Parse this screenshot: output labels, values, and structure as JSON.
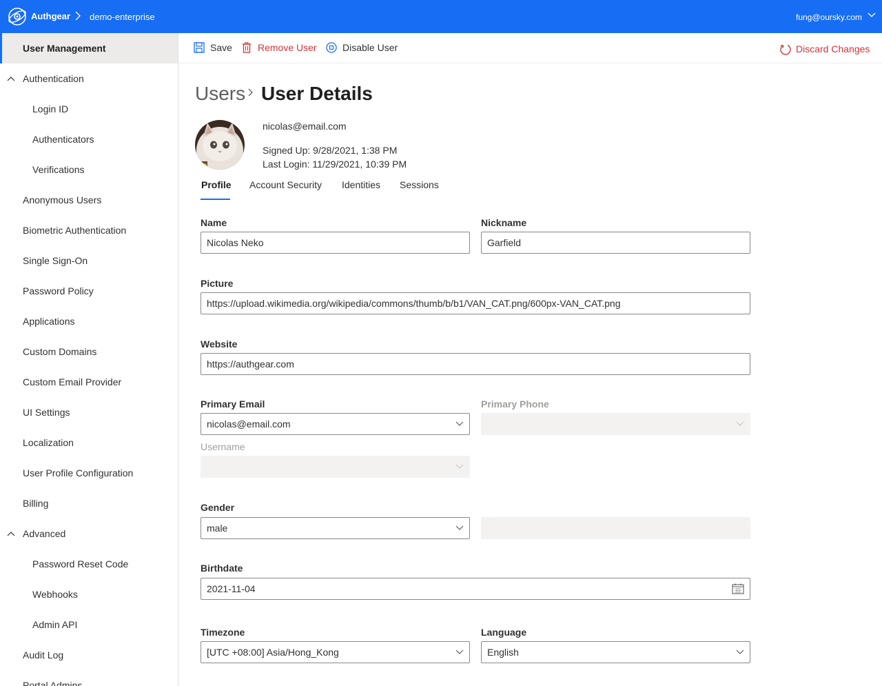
{
  "topbar": {
    "brand": "Authgear",
    "project": "demo-enterprise",
    "user_email": "fung@oursky.com",
    "color": "#176df3"
  },
  "sidebar": {
    "items": [
      {
        "label": "User Management",
        "active": true
      },
      {
        "label": "Authentication",
        "expanded": true
      },
      {
        "label": "Login ID"
      },
      {
        "label": "Authenticators"
      },
      {
        "label": "Verifications"
      },
      {
        "label": "Anonymous Users"
      },
      {
        "label": "Biometric Authentication"
      },
      {
        "label": "Single Sign-On"
      },
      {
        "label": "Password Policy"
      },
      {
        "label": "Applications"
      },
      {
        "label": "Custom Domains"
      },
      {
        "label": "Custom Email Provider"
      },
      {
        "label": "UI Settings"
      },
      {
        "label": "Localization"
      },
      {
        "label": "User Profile Configuration"
      },
      {
        "label": "Billing"
      },
      {
        "label": "Advanced",
        "expanded": true
      },
      {
        "label": "Password Reset Code"
      },
      {
        "label": "Webhooks"
      },
      {
        "label": "Admin API"
      },
      {
        "label": "Audit Log"
      },
      {
        "label": "Portal Admins"
      }
    ]
  },
  "commandbar": {
    "save": "Save",
    "remove_user": "Remove User",
    "disable_user": "Disable User",
    "discard_changes": "Discard Changes",
    "danger_color": "#d13438"
  },
  "header": {
    "breadcrumb_parent": "Users",
    "title": "User Details"
  },
  "user": {
    "email": "nicolas@email.com",
    "signed_up": "Signed Up: 9/28/2021, 1:38 PM",
    "last_login": "Last Login: 11/29/2021, 10:39 PM"
  },
  "tabs": [
    {
      "label": "Profile",
      "active": true
    },
    {
      "label": "Account Security"
    },
    {
      "label": "Identities"
    },
    {
      "label": "Sessions"
    }
  ],
  "form": {
    "name": {
      "label": "Name",
      "value": "Nicolas Neko"
    },
    "nickname": {
      "label": "Nickname",
      "value": "Garfield"
    },
    "picture": {
      "label": "Picture",
      "value": "https://upload.wikimedia.org/wikipedia/commons/thumb/b/b1/VAN_CAT.png/600px-VAN_CAT.png"
    },
    "website": {
      "label": "Website",
      "value": "https://authgear.com"
    },
    "primary_email": {
      "label": "Primary Email",
      "value": "nicolas@email.com"
    },
    "primary_phone": {
      "label": "Primary Phone",
      "value": "",
      "disabled": true
    },
    "username": {
      "label": "Username",
      "value": "",
      "disabled": true
    },
    "gender": {
      "label": "Gender",
      "value": "male"
    },
    "birthdate": {
      "label": "Birthdate",
      "value": "2021-11-04"
    },
    "timezone": {
      "label": "Timezone",
      "value": "[UTC +08:00] Asia/Hong_Kong"
    },
    "language": {
      "label": "Language",
      "value": "English"
    }
  }
}
